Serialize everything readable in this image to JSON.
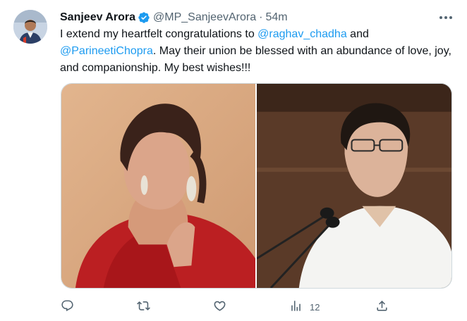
{
  "tweet": {
    "author": {
      "name": "Sanjeev Arora",
      "handle": "@MP_SanjeevArora",
      "separator": "·",
      "time": "54m",
      "verified": true
    },
    "text": {
      "part1": "I extend my heartfelt congratulations to ",
      "mention1": "@raghav_chadha",
      "part2": " and ",
      "mention2": "@ParineetiChopra",
      "part3": ". May their union be blessed with an abundance of love, joy, and companionship. My best wishes!!!"
    },
    "media": [
      {
        "subject": "woman in red saree with chandelier earrings"
      },
      {
        "subject": "man in white shirt speaking at microphones"
      }
    ],
    "actions": {
      "reply_icon": "reply-icon",
      "retweet_icon": "retweet-icon",
      "like_icon": "heart-icon",
      "views_icon": "views-icon",
      "views_count": "12",
      "share_icon": "share-icon"
    }
  },
  "colors": {
    "link": "#1d9bf0",
    "secondary_text": "#536471",
    "primary_text": "#0f1419",
    "verified_badge": "#1d9bf0"
  }
}
